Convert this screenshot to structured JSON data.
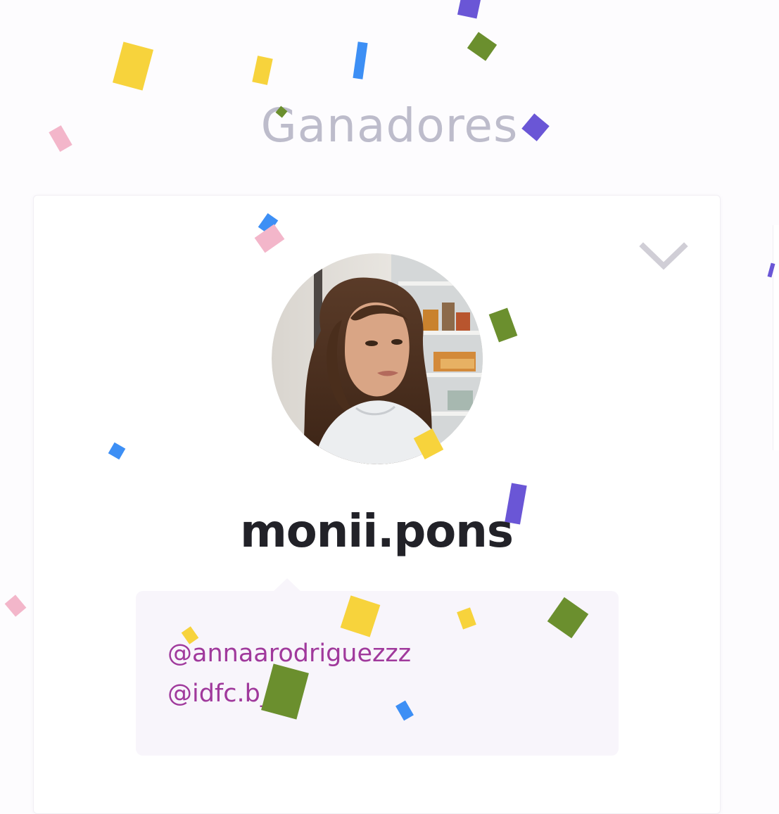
{
  "header": {
    "title": "Ganadores"
  },
  "winner": {
    "username": "monii.pons",
    "avatar_icon": "user-avatar-photo",
    "expand_icon": "chevron-down-icon",
    "mentions": [
      "@annaarodriguezzz",
      "@idfc.b__"
    ]
  },
  "colors": {
    "title": "#bdbccb",
    "username": "#222228",
    "mention": "#a0399c",
    "mention_box": "#f8f5fb",
    "chevron": "#d0ced6"
  },
  "confetti_colors": [
    "#f7d33c",
    "#3d8ff5",
    "#6b8f2e",
    "#6a56d6",
    "#f3b6ca"
  ]
}
